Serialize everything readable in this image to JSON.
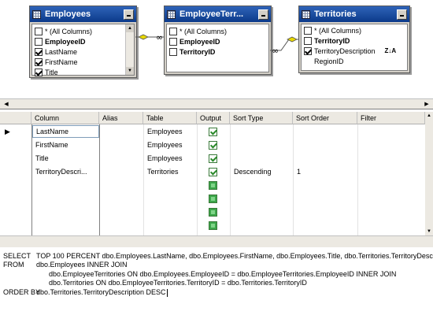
{
  "diagram": {
    "tables": [
      {
        "title": "Employees",
        "columns": [
          {
            "name": "* (All Columns)",
            "checked": false,
            "key": false
          },
          {
            "name": "EmployeeID",
            "checked": false,
            "key": true
          },
          {
            "name": "LastName",
            "checked": true,
            "key": false
          },
          {
            "name": "FirstName",
            "checked": true,
            "key": false
          },
          {
            "name": "Title",
            "checked": true,
            "key": false
          }
        ]
      },
      {
        "title": "EmployeeTerr...",
        "columns": [
          {
            "name": "* (All Columns)",
            "checked": false,
            "key": false
          },
          {
            "name": "EmployeeID",
            "checked": false,
            "key": true
          },
          {
            "name": "TerritoryID",
            "checked": false,
            "key": true
          }
        ]
      },
      {
        "title": "Territories",
        "columns": [
          {
            "name": "* (All Columns)",
            "checked": false,
            "key": false
          },
          {
            "name": "TerritoryID",
            "checked": false,
            "key": true
          },
          {
            "name": "TerritoryDescription",
            "checked": true,
            "key": false,
            "sort_icon": "Z↓A"
          },
          {
            "name": "RegionID",
            "checked": false,
            "key": false
          }
        ]
      }
    ]
  },
  "grid": {
    "headers": [
      "Column",
      "Alias",
      "Table",
      "Output",
      "Sort Type",
      "Sort Order",
      "Filter"
    ],
    "rows": [
      {
        "column": "LastName",
        "alias": "",
        "table": "Employees",
        "output": "checked",
        "sort_type": "",
        "sort_order": ""
      },
      {
        "column": "FirstName",
        "alias": "",
        "table": "Employees",
        "output": "checked",
        "sort_type": "",
        "sort_order": ""
      },
      {
        "column": "Title",
        "alias": "",
        "table": "Employees",
        "output": "checked",
        "sort_type": "",
        "sort_order": ""
      },
      {
        "column": "TerritoryDescri...",
        "alias": "",
        "table": "Territories",
        "output": "checked",
        "sort_type": "Descending",
        "sort_order": "1"
      },
      {
        "column": "",
        "alias": "",
        "table": "",
        "output": "empty",
        "sort_type": "",
        "sort_order": ""
      },
      {
        "column": "",
        "alias": "",
        "table": "",
        "output": "empty",
        "sort_type": "",
        "sort_order": ""
      },
      {
        "column": "",
        "alias": "",
        "table": "",
        "output": "empty",
        "sort_type": "",
        "sort_order": ""
      },
      {
        "column": "",
        "alias": "",
        "table": "",
        "output": "empty",
        "sort_type": "",
        "sort_order": ""
      }
    ]
  },
  "sql": {
    "keywords": [
      "SELECT",
      "FROM",
      "",
      "",
      "ORDER BY"
    ],
    "lines": [
      "TOP 100 PERCENT dbo.Employees.LastName, dbo.Employees.FirstName, dbo.Employees.Title, dbo.Territories.TerritoryDescription",
      "dbo.Employees INNER JOIN",
      "dbo.EmployeeTerritories ON dbo.Employees.EmployeeID = dbo.EmployeeTerritories.EmployeeID INNER JOIN",
      "dbo.Territories ON dbo.EmployeeTerritories.TerritoryID = dbo.Territories.TerritoryID",
      "dbo.Territories.TerritoryDescription DESC"
    ]
  },
  "colors": {
    "title_bar": "#0b3a8a",
    "pane_background": "#ffffff",
    "chrome": "#d4d0c8",
    "output_check": "#2a8a2a"
  }
}
